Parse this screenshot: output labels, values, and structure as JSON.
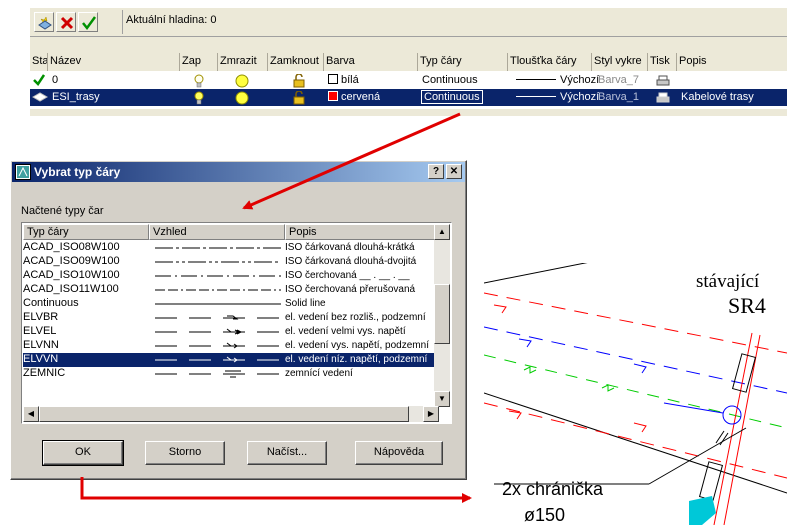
{
  "layer_manager": {
    "toolbar": {
      "new_icon": "new-layer-icon",
      "delete_icon": "delete-icon",
      "current_icon": "checkmark-icon"
    },
    "current_layer_label": "Aktuální hladina: 0",
    "columns": [
      "Sta",
      "Název",
      "Zap",
      "Zmrazit",
      "Zamknout",
      "Barva",
      "Typ čáry",
      "Tloušťka čáry",
      "Styl vykre",
      "Tisk",
      "Popis"
    ],
    "rows": [
      {
        "status_icon": "checkmark-icon",
        "name": "0",
        "on_icon": "lightbulb-icon",
        "freeze_icon": "sun-icon",
        "lock_icon": "padlock-icon",
        "color_swatch": "#ffffff",
        "color_name": "bílá",
        "linetype": "Continuous",
        "lineweight": "Výchozí",
        "plot_style": "Barva_7",
        "plot_icon": "printer-icon",
        "description": "",
        "selected": false
      },
      {
        "status_icon": "layer-icon",
        "name": "ESI_trasy",
        "on_icon": "lightbulb-icon",
        "freeze_icon": "sun-icon",
        "lock_icon": "padlock-icon",
        "color_swatch": "#ff0000",
        "color_name": "cervená",
        "linetype": "Continuous",
        "lineweight": "Výchozí",
        "plot_style": "Barva_1",
        "plot_icon": "printer-icon",
        "description": "Kabelové trasy",
        "selected": true
      }
    ]
  },
  "dialog": {
    "title": "Vybrat typ čáry",
    "help_icon": "help-icon",
    "close_icon": "close-icon",
    "loaded_label": "Načtené typy čar",
    "columns": [
      "Typ čáry",
      "Vzhled",
      "Popis"
    ],
    "linetypes": [
      {
        "name": "ACAD_ISO08W100",
        "description": "ISO čárkovaná dlouhá-krátká",
        "pattern": "longshort"
      },
      {
        "name": "ACAD_ISO09W100",
        "description": "ISO čárkovaná dlouhá-dvojitá",
        "pattern": "longdouble"
      },
      {
        "name": "ACAD_ISO10W100",
        "description": "ISO čerchovaná __ . __ . __",
        "pattern": "dashdot"
      },
      {
        "name": "ACAD_ISO11W100",
        "description": "ISO čerchovaná přerušovaná",
        "pattern": "dashdashdot"
      },
      {
        "name": "Continuous",
        "description": "Solid line",
        "pattern": "solid"
      },
      {
        "name": "ELVBR",
        "description": "el. vedení bez rozliš., podzemní",
        "pattern": "elv1"
      },
      {
        "name": "ELVEL",
        "description": "el. vedení velmi vys. napětí",
        "pattern": "elv3"
      },
      {
        "name": "ELVNN",
        "description": "el. vedení vys. napětí, podzemní",
        "pattern": "elv2"
      },
      {
        "name": "ELVVN",
        "description": "el. vedení níz. napětí, podzemní",
        "pattern": "elv2",
        "selected": true
      },
      {
        "name": "ZEMNIC",
        "description": "zemnící vedení",
        "pattern": "earth"
      }
    ],
    "buttons": {
      "ok": "OK",
      "cancel": "Storno",
      "load": "Načíst...",
      "help": "Nápověda"
    }
  },
  "cad": {
    "label_top": "stávající",
    "label_code": "SR4",
    "label_protector": "2x chránička",
    "label_diameter": "ø150",
    "colors": {
      "red": "#ff0000",
      "blue": "#0000ff",
      "green": "#00cc00",
      "cyan": "#00c8d8"
    }
  },
  "annotations": {
    "arrow_color": "#e00000"
  }
}
